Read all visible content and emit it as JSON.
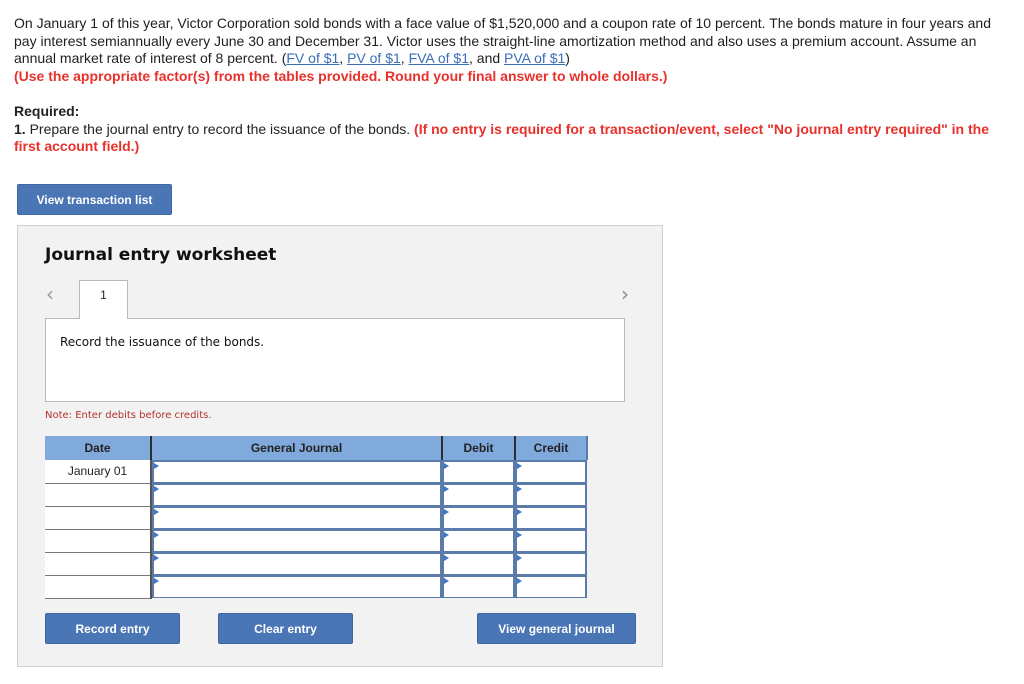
{
  "problem": {
    "text_before_links": "On January 1 of this year, Victor Corporation sold bonds with a face value of $1,520,000 and a coupon rate of 10 percent.  The bonds mature in four years and pay interest semiannually every June 30 and December 31. Victor uses the straight-line amortization method and also uses a premium account. Assume an annual market rate of interest of 8 percent. (",
    "links": [
      "FV of $1",
      "PV of $1",
      "FVA of $1",
      "PVA of $1"
    ],
    "sep1": ", ",
    "sep2": ", ",
    "sep3": ", and ",
    "text_after_links": ")",
    "instruction": "(Use the appropriate factor(s) from the tables provided. Round your final answer to whole dollars.)"
  },
  "required": {
    "heading": "Required:",
    "number": "1.",
    "text": " Prepare the journal entry to record the issuance of the bonds. ",
    "instruction": "(If no entry is required for a transaction/event, select \"No journal entry required\" in the first account field.)"
  },
  "buttons": {
    "view_transaction_list": "View transaction list",
    "record_entry": "Record entry",
    "clear_entry": "Clear entry",
    "view_general_journal": "View general journal"
  },
  "worksheet": {
    "title": "Journal entry worksheet",
    "prev_icon": "‹",
    "next_icon": "›",
    "active_tab": "1",
    "description": "Record the issuance of the bonds.",
    "note": "Note: Enter debits before credits.",
    "columns": [
      "Date",
      "General Journal",
      "Debit",
      "Credit"
    ],
    "rows": [
      {
        "date": "January 01",
        "account": "",
        "debit": "",
        "credit": ""
      },
      {
        "date": "",
        "account": "",
        "debit": "",
        "credit": ""
      },
      {
        "date": "",
        "account": "",
        "debit": "",
        "credit": ""
      },
      {
        "date": "",
        "account": "",
        "debit": "",
        "credit": ""
      },
      {
        "date": "",
        "account": "",
        "debit": "",
        "credit": ""
      },
      {
        "date": "",
        "account": "",
        "debit": "",
        "credit": ""
      }
    ]
  },
  "colors": {
    "button_blue": "#4a76b5",
    "header_blue": "#80a9dc",
    "instruction_red": "#e8312b",
    "link_blue": "#3a6db5"
  }
}
